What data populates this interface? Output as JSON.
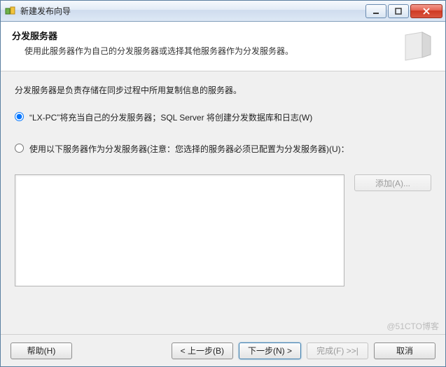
{
  "window": {
    "title": "新建发布向导"
  },
  "header": {
    "title": "分发服务器",
    "subtitle": "使用此服务器作为自己的分发服务器或选择其他服务器作为分发服务器。"
  },
  "content": {
    "description": "分发服务器是负责存储在同步过程中所用复制信息的服务器。",
    "option_self": "“LX-PC”将充当自己的分发服务器；SQL Server 将创建分发数据库和日志(W)",
    "option_other": "使用以下服务器作为分发服务器(注意：您选择的服务器必须已配置为分发服务器)(U)："
  },
  "buttons": {
    "add": "添加(A)...",
    "help": "帮助(H)",
    "back": "< 上一步(B)",
    "next": "下一步(N) >",
    "finish": "完成(F) >>|",
    "cancel": "取消"
  },
  "watermark": "@51CTO博客"
}
